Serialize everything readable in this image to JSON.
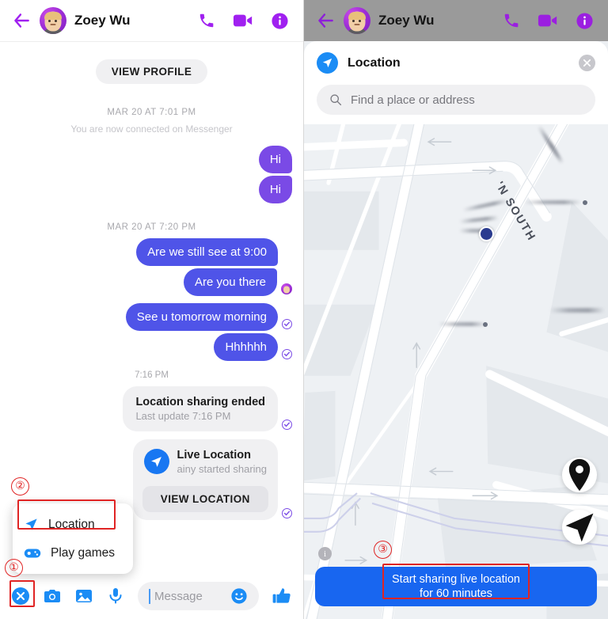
{
  "header": {
    "contact_name": "Zoey Wu",
    "back_icon": "back-arrow-icon",
    "call_icon": "phone-icon",
    "video_icon": "video-camera-icon",
    "info_icon": "info-circle-icon"
  },
  "left_panel": {
    "view_profile_label": "VIEW PROFILE",
    "day_stamp_1": "MAR 20 AT 7:01 PM",
    "system_note": "You are now connected on Messenger",
    "day_stamp_2": "MAR 20 AT 7:20 PM",
    "messages": [
      {
        "text": "Hi",
        "side": "out",
        "color": "purple"
      },
      {
        "text": "Hi",
        "side": "out",
        "color": "purple"
      },
      {
        "text": "Are we still see at 9:00",
        "side": "out",
        "color": "blue"
      },
      {
        "text": "Are you there",
        "side": "out",
        "color": "blue"
      },
      {
        "text": "See u tomorrow morning",
        "side": "out",
        "color": "blue"
      },
      {
        "text": "Hhhhhh",
        "side": "out",
        "color": "blue"
      }
    ],
    "time_stamp": "7:16 PM",
    "ended_card": {
      "title": "Location sharing ended",
      "subtitle": "Last update 7:16 PM"
    },
    "live_card": {
      "title": "Live Location",
      "subtitle": "ainy started sharing",
      "button_label": "VIEW LOCATION"
    },
    "composer": {
      "close_icon": "close-circle-icon",
      "camera_icon": "camera-icon",
      "gallery_icon": "photo-gallery-icon",
      "mic_icon": "microphone-icon",
      "message_placeholder": "Message",
      "emoji_icon": "smiley-face-icon",
      "like_icon": "thumbs-up-icon"
    },
    "popup_menu": {
      "items": [
        {
          "label": "Location",
          "icon": "location-arrow-icon"
        },
        {
          "label": "Play games",
          "icon": "game-controller-icon"
        }
      ]
    }
  },
  "right_panel": {
    "sheet_title": "Location",
    "location_icon": "location-arrow-icon",
    "close_icon": "close-x-icon",
    "search_placeholder": "Find a place or address",
    "search_icon": "magnifier-icon",
    "map": {
      "street_label": "'N SOUTH",
      "pin_fab_icon": "map-pin-icon",
      "recenter_fab_icon": "navigation-arrow-icon",
      "info_badge": "i",
      "user_location_marker": "blue-location-dot"
    },
    "share_button": {
      "line1": "Start sharing live location",
      "line2": "for 60 minutes"
    }
  },
  "annotations": {
    "markers": [
      {
        "number": "①",
        "target": "composer-close-button"
      },
      {
        "number": "②",
        "target": "popup-location-item"
      },
      {
        "number": "③",
        "target": "start-sharing-button"
      }
    ]
  },
  "colors": {
    "purple_bubble": "#7a4ae6",
    "blue_bubble": "#4f54e8",
    "brand_purple": "#a020f0",
    "messenger_blue": "#1877f2",
    "share_blue": "#1866f0",
    "annotation_red": "#e02424"
  }
}
